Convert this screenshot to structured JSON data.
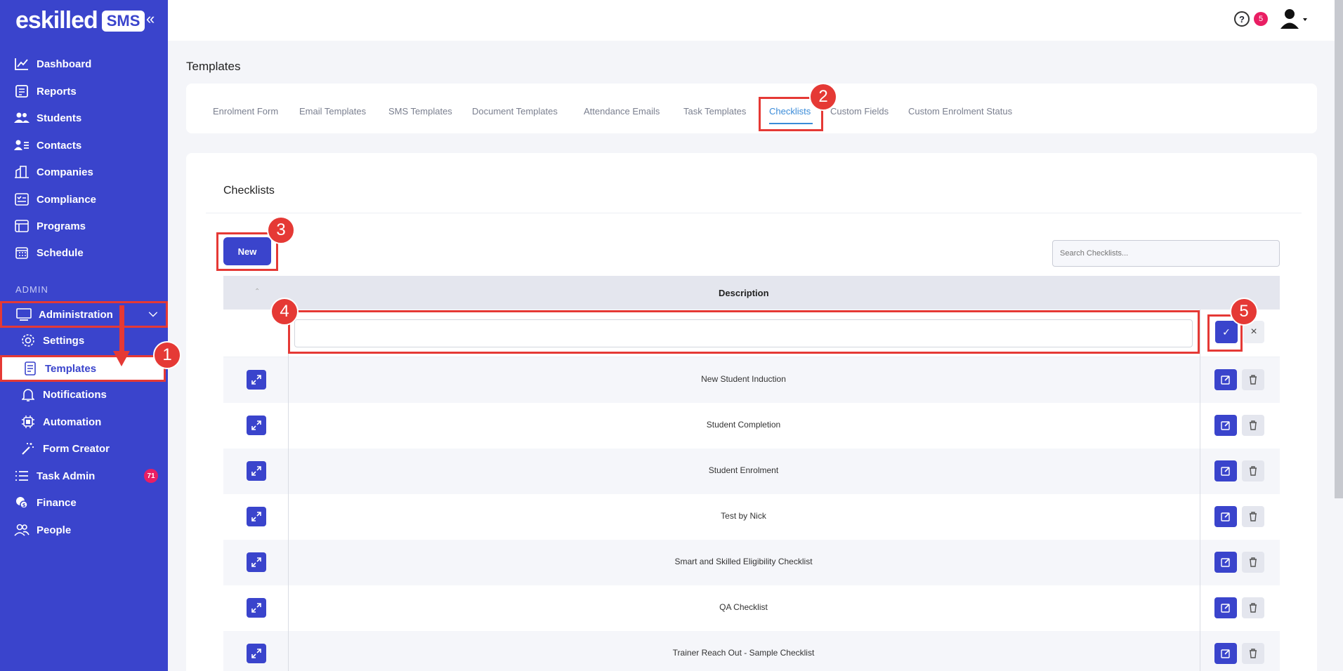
{
  "brand": {
    "logo_text": "eskilled",
    "logo_badge": "SMS",
    "collapse_icon": "«"
  },
  "sidebar": {
    "items": [
      {
        "label": "Dashboard",
        "icon": "chart-line-icon"
      },
      {
        "label": "Reports",
        "icon": "report-icon"
      },
      {
        "label": "Students",
        "icon": "students-icon"
      },
      {
        "label": "Contacts",
        "icon": "contacts-icon"
      },
      {
        "label": "Companies",
        "icon": "building-icon"
      },
      {
        "label": "Compliance",
        "icon": "compliance-icon"
      },
      {
        "label": "Programs",
        "icon": "programs-icon"
      },
      {
        "label": "Schedule",
        "icon": "calendar-icon"
      }
    ],
    "section_label": "ADMIN",
    "admin": {
      "label": "Administration",
      "icon": "monitor-icon"
    },
    "admin_children": [
      {
        "label": "Settings",
        "icon": "gear-icon"
      },
      {
        "label": "Templates",
        "icon": "document-icon"
      },
      {
        "label": "Notifications",
        "icon": "bell-icon"
      },
      {
        "label": "Automation",
        "icon": "chip-icon"
      },
      {
        "label": "Form Creator",
        "icon": "wand-icon"
      }
    ],
    "bottom": [
      {
        "label": "Task Admin",
        "icon": "list-icon",
        "badge": "71"
      },
      {
        "label": "Finance",
        "icon": "finance-icon"
      },
      {
        "label": "People",
        "icon": "people-icon"
      }
    ]
  },
  "topbar": {
    "help": "?",
    "notifications": "5"
  },
  "page": {
    "title": "Templates"
  },
  "tabs": [
    "Enrolment Form",
    "Email Templates",
    "SMS Templates",
    "Document Templates",
    "Attendance Emails",
    "Task Templates",
    "Checklists",
    "Custom Fields",
    "Custom Enrolment Status"
  ],
  "active_tab": "Checklists",
  "checklists": {
    "title": "Checklists",
    "new_label": "New",
    "search_placeholder": "Search Checklists...",
    "column_header": "Description",
    "rows": [
      "New Student Induction",
      "Student Completion",
      "Student Enrolment",
      "Test by Nick",
      "Smart and Skilled Eligibility Checklist",
      "QA Checklist",
      "Trainer Reach Out - Sample Checklist"
    ]
  },
  "annotations": [
    "1",
    "2",
    "3",
    "4",
    "5"
  ],
  "colors": {
    "primary": "#3a44cc",
    "highlight": "#e53935",
    "badge": "#e91e63",
    "active_tab": "#3a8bd8"
  }
}
